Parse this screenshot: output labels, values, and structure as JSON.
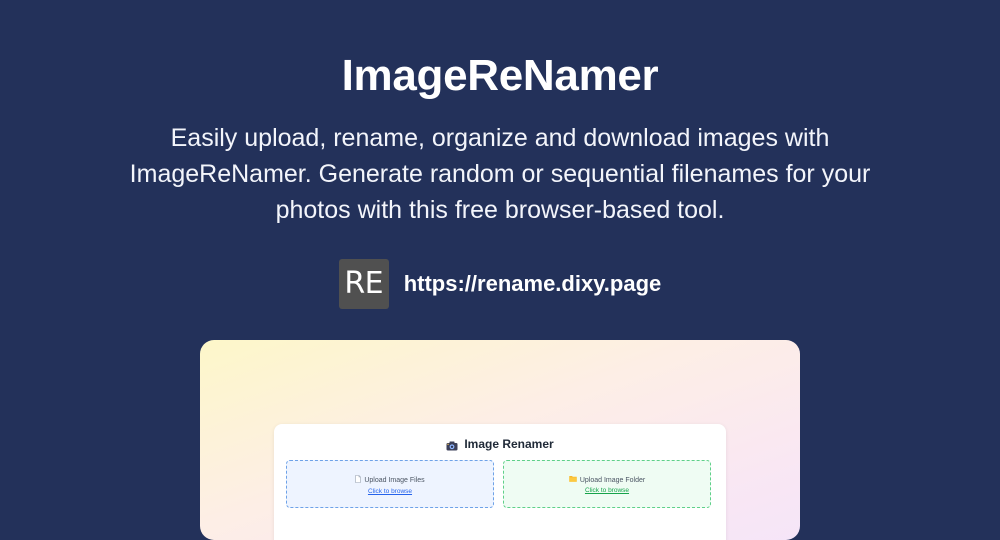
{
  "header": {
    "title": "ImageReNamer",
    "subtitle": "Easily upload, rename, organize and download images with ImageReNamer. Generate random or sequential filenames for your photos with this free browser-based tool."
  },
  "site": {
    "logo_text": "RE",
    "url": "https://rename.dixy.page"
  },
  "preview": {
    "app_title": "Image Renamer",
    "title_icon": "camera-icon",
    "upload_files": {
      "icon": "document-icon",
      "label": "Upload Image Files",
      "link": "Click to browse"
    },
    "upload_folder": {
      "icon": "folder-icon",
      "label": "Upload Image Folder",
      "link": "Click to browse"
    }
  },
  "colors": {
    "background": "#23315a",
    "logo_bg": "#505050",
    "files_border": "#6ea2e8",
    "folder_border": "#5fd089"
  }
}
